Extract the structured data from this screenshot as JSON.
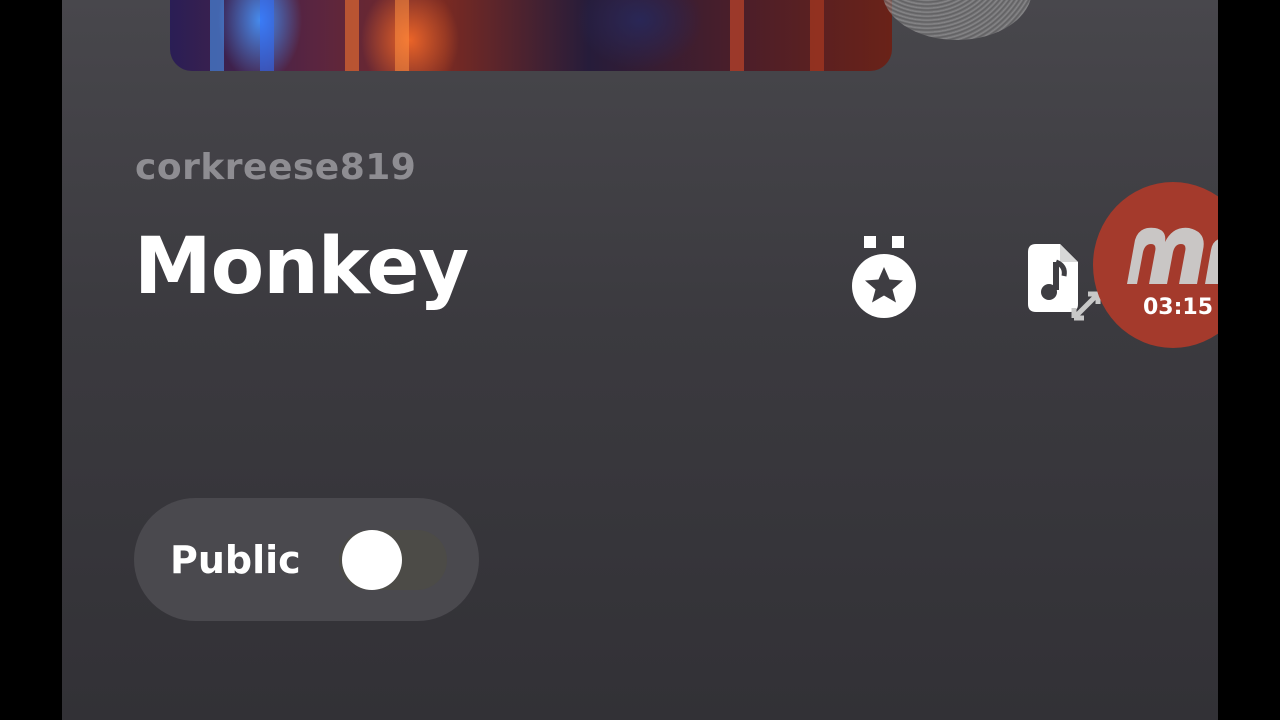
{
  "header": {
    "username": "corkreese819"
  },
  "song": {
    "title": "Monkey"
  },
  "actions": {
    "badge_icon": "medal-star-icon",
    "song_icon": "music-file-expand-icon"
  },
  "record": {
    "logo_icon": "m-logo-icon",
    "time": "03:15",
    "color": "#a43a2c"
  },
  "visibility": {
    "label": "Public",
    "enabled": false
  },
  "colors": {
    "background": "#3b3a3f",
    "accent": "#a43a2c",
    "text": "#ffffff",
    "muted": "#8e8d92"
  }
}
